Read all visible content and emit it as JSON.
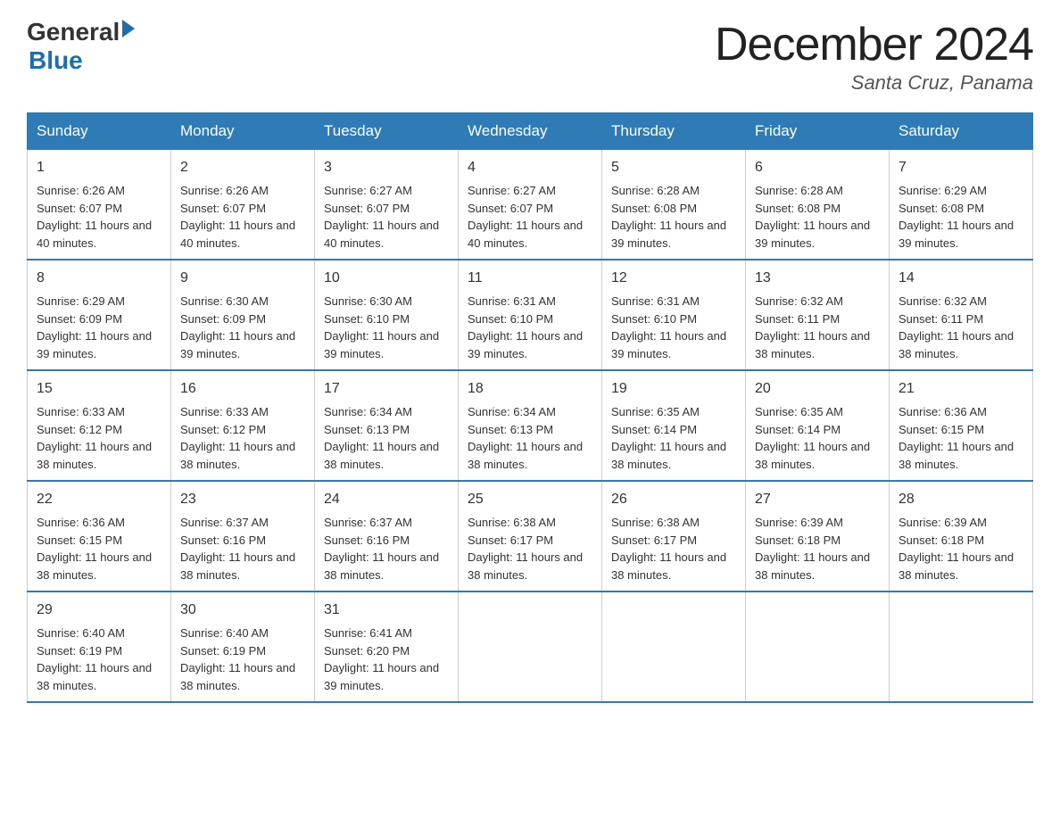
{
  "logo": {
    "general": "General",
    "blue": "Blue"
  },
  "header": {
    "month": "December 2024",
    "location": "Santa Cruz, Panama"
  },
  "days_header": [
    "Sunday",
    "Monday",
    "Tuesday",
    "Wednesday",
    "Thursday",
    "Friday",
    "Saturday"
  ],
  "weeks": [
    [
      {
        "day": "1",
        "sunrise": "6:26 AM",
        "sunset": "6:07 PM",
        "daylight": "11 hours and 40 minutes."
      },
      {
        "day": "2",
        "sunrise": "6:26 AM",
        "sunset": "6:07 PM",
        "daylight": "11 hours and 40 minutes."
      },
      {
        "day": "3",
        "sunrise": "6:27 AM",
        "sunset": "6:07 PM",
        "daylight": "11 hours and 40 minutes."
      },
      {
        "day": "4",
        "sunrise": "6:27 AM",
        "sunset": "6:07 PM",
        "daylight": "11 hours and 40 minutes."
      },
      {
        "day": "5",
        "sunrise": "6:28 AM",
        "sunset": "6:08 PM",
        "daylight": "11 hours and 39 minutes."
      },
      {
        "day": "6",
        "sunrise": "6:28 AM",
        "sunset": "6:08 PM",
        "daylight": "11 hours and 39 minutes."
      },
      {
        "day": "7",
        "sunrise": "6:29 AM",
        "sunset": "6:08 PM",
        "daylight": "11 hours and 39 minutes."
      }
    ],
    [
      {
        "day": "8",
        "sunrise": "6:29 AM",
        "sunset": "6:09 PM",
        "daylight": "11 hours and 39 minutes."
      },
      {
        "day": "9",
        "sunrise": "6:30 AM",
        "sunset": "6:09 PM",
        "daylight": "11 hours and 39 minutes."
      },
      {
        "day": "10",
        "sunrise": "6:30 AM",
        "sunset": "6:10 PM",
        "daylight": "11 hours and 39 minutes."
      },
      {
        "day": "11",
        "sunrise": "6:31 AM",
        "sunset": "6:10 PM",
        "daylight": "11 hours and 39 minutes."
      },
      {
        "day": "12",
        "sunrise": "6:31 AM",
        "sunset": "6:10 PM",
        "daylight": "11 hours and 39 minutes."
      },
      {
        "day": "13",
        "sunrise": "6:32 AM",
        "sunset": "6:11 PM",
        "daylight": "11 hours and 38 minutes."
      },
      {
        "day": "14",
        "sunrise": "6:32 AM",
        "sunset": "6:11 PM",
        "daylight": "11 hours and 38 minutes."
      }
    ],
    [
      {
        "day": "15",
        "sunrise": "6:33 AM",
        "sunset": "6:12 PM",
        "daylight": "11 hours and 38 minutes."
      },
      {
        "day": "16",
        "sunrise": "6:33 AM",
        "sunset": "6:12 PM",
        "daylight": "11 hours and 38 minutes."
      },
      {
        "day": "17",
        "sunrise": "6:34 AM",
        "sunset": "6:13 PM",
        "daylight": "11 hours and 38 minutes."
      },
      {
        "day": "18",
        "sunrise": "6:34 AM",
        "sunset": "6:13 PM",
        "daylight": "11 hours and 38 minutes."
      },
      {
        "day": "19",
        "sunrise": "6:35 AM",
        "sunset": "6:14 PM",
        "daylight": "11 hours and 38 minutes."
      },
      {
        "day": "20",
        "sunrise": "6:35 AM",
        "sunset": "6:14 PM",
        "daylight": "11 hours and 38 minutes."
      },
      {
        "day": "21",
        "sunrise": "6:36 AM",
        "sunset": "6:15 PM",
        "daylight": "11 hours and 38 minutes."
      }
    ],
    [
      {
        "day": "22",
        "sunrise": "6:36 AM",
        "sunset": "6:15 PM",
        "daylight": "11 hours and 38 minutes."
      },
      {
        "day": "23",
        "sunrise": "6:37 AM",
        "sunset": "6:16 PM",
        "daylight": "11 hours and 38 minutes."
      },
      {
        "day": "24",
        "sunrise": "6:37 AM",
        "sunset": "6:16 PM",
        "daylight": "11 hours and 38 minutes."
      },
      {
        "day": "25",
        "sunrise": "6:38 AM",
        "sunset": "6:17 PM",
        "daylight": "11 hours and 38 minutes."
      },
      {
        "day": "26",
        "sunrise": "6:38 AM",
        "sunset": "6:17 PM",
        "daylight": "11 hours and 38 minutes."
      },
      {
        "day": "27",
        "sunrise": "6:39 AM",
        "sunset": "6:18 PM",
        "daylight": "11 hours and 38 minutes."
      },
      {
        "day": "28",
        "sunrise": "6:39 AM",
        "sunset": "6:18 PM",
        "daylight": "11 hours and 38 minutes."
      }
    ],
    [
      {
        "day": "29",
        "sunrise": "6:40 AM",
        "sunset": "6:19 PM",
        "daylight": "11 hours and 38 minutes."
      },
      {
        "day": "30",
        "sunrise": "6:40 AM",
        "sunset": "6:19 PM",
        "daylight": "11 hours and 38 minutes."
      },
      {
        "day": "31",
        "sunrise": "6:41 AM",
        "sunset": "6:20 PM",
        "daylight": "11 hours and 39 minutes."
      },
      null,
      null,
      null,
      null
    ]
  ]
}
